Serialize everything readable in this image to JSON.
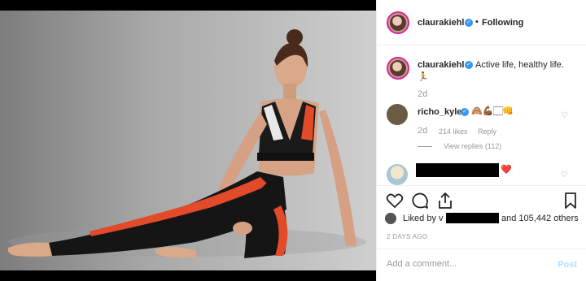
{
  "header": {
    "username": "claurakiehl",
    "separator": "•",
    "follow_status": "Following"
  },
  "caption": {
    "username": "claurakiehl",
    "text": "Active life, healthy life.",
    "emoji": "🏃",
    "time": "2d"
  },
  "comments": [
    {
      "username": "richo_kyle",
      "text": "🙈💪🏾🏻👊",
      "time": "2d",
      "likes": "214 likes",
      "reply_label": "Reply",
      "view_replies": "View replies (112)"
    },
    {
      "username": "",
      "text": "❤️"
    }
  ],
  "likes_line": {
    "prefix": "Liked by v",
    "suffix": "and 105,442 others"
  },
  "post_date": "2 DAYS AGO",
  "comment_input": {
    "placeholder": "Add a comment..."
  },
  "post_button": "Post",
  "colors": {
    "verified": "#3897f0",
    "heart": "#ed4956",
    "post_disabled": "#b2dffc"
  },
  "icons": [
    "heart-icon",
    "comment-icon",
    "share-icon",
    "bookmark-icon",
    "verified-icon"
  ]
}
